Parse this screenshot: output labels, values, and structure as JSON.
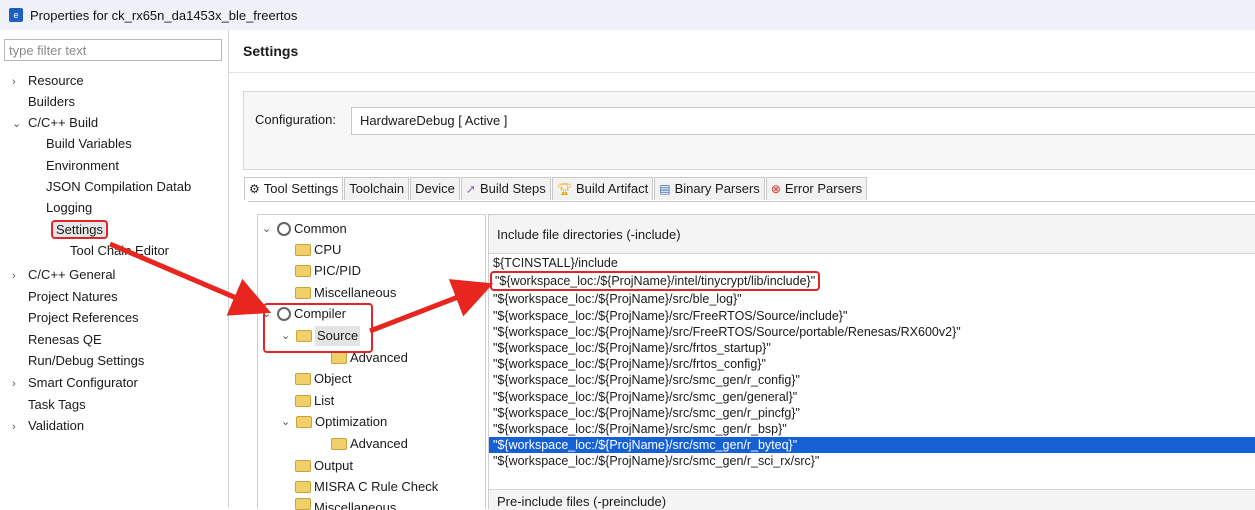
{
  "window": {
    "title": "Properties for ck_rx65n_da1453x_ble_freertos"
  },
  "filter": {
    "placeholder": "type filter text"
  },
  "nav": [
    {
      "label": "Resource",
      "twisty": "›"
    },
    {
      "label": "Builders"
    },
    {
      "label": "C/C++ Build",
      "twisty": "⌄"
    },
    {
      "label": "Build Variables"
    },
    {
      "label": "Environment"
    },
    {
      "label": "JSON Compilation Datab"
    },
    {
      "label": "Logging"
    },
    {
      "label": "Settings"
    },
    {
      "label": "Tool Chain Editor"
    },
    {
      "label": "C/C++ General",
      "twisty": "›"
    },
    {
      "label": "Project Natures"
    },
    {
      "label": "Project References"
    },
    {
      "label": "Renesas QE"
    },
    {
      "label": "Run/Debug Settings"
    },
    {
      "label": "Smart Configurator",
      "twisty": "›"
    },
    {
      "label": "Task Tags"
    },
    {
      "label": "Validation",
      "twisty": "›"
    }
  ],
  "header": {
    "title": "Settings"
  },
  "config": {
    "label": "Configuration:",
    "value": "HardwareDebug  [ Active ]"
  },
  "tabs": [
    {
      "label": "Tool Settings",
      "icon": "gear-icon"
    },
    {
      "label": "Toolchain",
      "icon": ""
    },
    {
      "label": "Device",
      "icon": ""
    },
    {
      "label": "Build Steps",
      "icon": "build-steps-icon"
    },
    {
      "label": "Build Artifact",
      "icon": "trophy-icon"
    },
    {
      "label": "Binary Parsers",
      "icon": "binary-icon"
    },
    {
      "label": "Error Parsers",
      "icon": "error-icon"
    }
  ],
  "tool_tree": [
    {
      "label": "Common",
      "icon": "gear-icon",
      "twisty": "⌄"
    },
    {
      "label": "CPU",
      "icon": "folder-icon"
    },
    {
      "label": "PIC/PID",
      "icon": "folder-icon"
    },
    {
      "label": "Miscellaneous",
      "icon": "folder-icon"
    },
    {
      "label": "Compiler",
      "icon": "gear-icon",
      "twisty": "⌄"
    },
    {
      "label": "Source",
      "icon": "folder-icon",
      "twisty": "⌄"
    },
    {
      "label": "Advanced",
      "icon": "folder-icon"
    },
    {
      "label": "Object",
      "icon": "folder-icon"
    },
    {
      "label": "List",
      "icon": "folder-icon"
    },
    {
      "label": "Optimization",
      "icon": "folder-icon",
      "twisty": "⌄"
    },
    {
      "label": "Advanced",
      "icon": "folder-icon"
    },
    {
      "label": "Output",
      "icon": "folder-icon"
    },
    {
      "label": "MISRA C Rule Check",
      "icon": "folder-icon"
    },
    {
      "label": "Miscellaneous",
      "icon": "folder-icon"
    }
  ],
  "include": {
    "title": "Include file directories (-include)",
    "paths": [
      "${TCINSTALL}/include",
      "\"${workspace_loc:/${ProjName}/intel/tinycrypt/lib/include}\"",
      "\"${workspace_loc:/${ProjName}/src/ble_log}\"",
      "\"${workspace_loc:/${ProjName}/src/FreeRTOS/Source/include}\"",
      "\"${workspace_loc:/${ProjName}/src/FreeRTOS/Source/portable/Renesas/RX600v2}\"",
      "\"${workspace_loc:/${ProjName}/src/frtos_startup}\"",
      "\"${workspace_loc:/${ProjName}/src/frtos_config}\"",
      "\"${workspace_loc:/${ProjName}/src/smc_gen/r_config}\"",
      "\"${workspace_loc:/${ProjName}/src/smc_gen/general}\"",
      "\"${workspace_loc:/${ProjName}/src/smc_gen/r_pincfg}\"",
      "\"${workspace_loc:/${ProjName}/src/smc_gen/r_bsp}\"",
      "\"${workspace_loc:/${ProjName}/src/smc_gen/r_byteq}\"",
      "\"${workspace_loc:/${ProjName}/src/smc_gen/r_sci_rx/src}\""
    ]
  },
  "preinclude": {
    "title": "Pre-include files (-preinclude)"
  },
  "colors": {
    "highlight_border": "#e0262a",
    "selection": "#1660d6",
    "arrow": "#e8261f"
  }
}
